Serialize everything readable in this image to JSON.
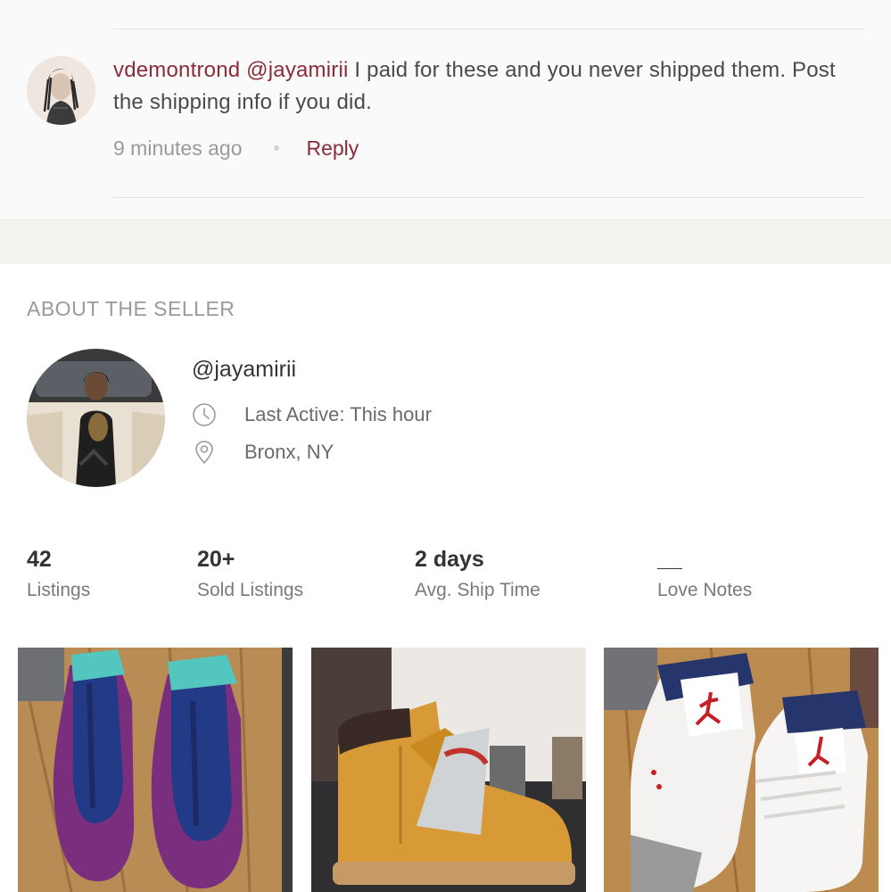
{
  "comment": {
    "author": "vdemontrond",
    "mention": "@jayamirii",
    "text": " I paid for these and you never shipped them. Post the shipping info if you did.",
    "time": "9 minutes ago",
    "reply_label": "Reply"
  },
  "seller": {
    "section_title": "ABOUT THE SELLER",
    "username": "@jayamirii",
    "last_active": "Last Active: This hour",
    "location": "Bronx, NY",
    "icons": {
      "time": "clock-icon",
      "location": "location-pin-icon"
    }
  },
  "stats": [
    {
      "value": "42",
      "label": "Listings"
    },
    {
      "value": "20+",
      "label": "Sold Listings"
    },
    {
      "value": "2 days",
      "label": "Avg. Ship Time"
    },
    {
      "value": "__",
      "label": "Love Notes"
    }
  ],
  "listings": [
    {
      "image": "purple-navy-sneakers-photo"
    },
    {
      "image": "wheat-boots-photo"
    },
    {
      "image": "white-cement-sneakers-photo"
    }
  ],
  "colors": {
    "accent": "#8a2b3a",
    "muted_text": "#9a9a9a",
    "band": "#f4f3ef"
  }
}
